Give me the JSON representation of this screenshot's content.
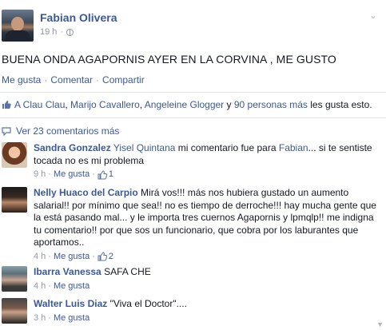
{
  "post": {
    "author": "Fabian Olivera",
    "time": "19 h",
    "separator": "·",
    "text": "BUENA ONDA AGAPORNIS AYER EN LA CORVINA , ME GUSTO",
    "actions": [
      "Me gusta",
      "Comentar",
      "Compartir"
    ],
    "likes": {
      "names": [
        "A Clau Clau",
        "Marijo Cavallero",
        "Angeleine Glogger"
      ],
      "connector": "y",
      "others": "90 personas más",
      "suffix": "les gusta esto."
    },
    "view_comments": "Ver 23 comentarios más"
  },
  "comments": [
    {
      "author": "Sandra Gonzalez",
      "mention": "Yisel Quintana",
      "text_before": "mi comentario fue para",
      "mention2": "Fabian",
      "text_after": "... si te sentiste tocada no es mi problema",
      "time": "9 h",
      "like_label": "Me gusta",
      "likes": "1"
    },
    {
      "author": "Nelly Huaco del Carpio",
      "text": "Mirá vos!!! más nos hubiera gustado un aumento salarial!! por mínimo que sea!! no es tiempo de derroche!!! hay mucha gente que la está pasando mal... y le importa tres cuernos Agapornis y lpmqlp!! me indigna tu comentario!! por que sos un funcionario, que cobra por los laburantes que aportamos..",
      "time": "4 h",
      "like_label": "Me gusta",
      "likes": "2"
    },
    {
      "author": "Ibarra Vanessa",
      "text": "SAFA CHE",
      "time": "4 h",
      "like_label": "Me gusta"
    },
    {
      "author": "Walter Luis Diaz",
      "text": "\"Viva el Doctor\"....",
      "time": "3 h",
      "like_label": "Me gusta"
    }
  ],
  "colors": {
    "link": "#3b5998",
    "meta": "#9197a3",
    "text": "#141823"
  },
  "icons": {
    "privacy": "globe-icon",
    "like": "thumbs-up-icon",
    "comments": "speech-bubble-icon",
    "options": "chevron-down-icon"
  }
}
